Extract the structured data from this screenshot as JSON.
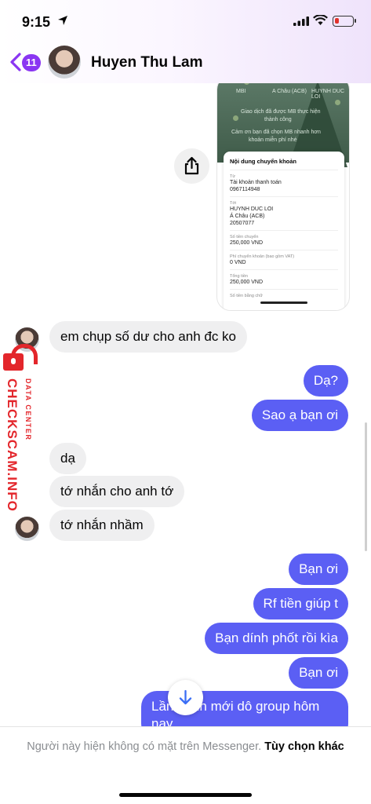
{
  "status_bar": {
    "time": "9:15"
  },
  "header": {
    "back_badge": "11",
    "contact_name": "Huyen Thu Lam"
  },
  "shared_image": {
    "faint_lines": [
      "MBI",
      "A Châu (ACB)",
      "HUYNH DUC LOI",
      "Giao dịch đã được MB thực hiện",
      "thành công",
      "Cảm ơn bạn đã chọn MB nhanh hơn",
      "khoản miễn phí nhé"
    ],
    "card_title": "Nội dung chuyển khoản",
    "fields": [
      {
        "label": "Từ",
        "lines": [
          "Tài khoản thanh toán",
          "0967114948"
        ]
      },
      {
        "label": "Tới",
        "lines": [
          "HUYNH DUC LOI",
          "Á Châu (ACB)",
          "20507077"
        ]
      },
      {
        "label": "Số tiền chuyển",
        "lines": [
          "250,000 VND"
        ]
      },
      {
        "label": "Phí chuyển khoản (bao gồm VAT)",
        "lines": [
          "0 VND"
        ]
      },
      {
        "label": "Tổng tiền",
        "lines": [
          "250,000 VND"
        ]
      },
      {
        "label": "Số tiền bằng chữ",
        "lines": []
      }
    ]
  },
  "watermark": {
    "brand": "CHECKSCAM.INFO",
    "sub": "DATA CENTER"
  },
  "messages": [
    {
      "dir": "in",
      "text": "em chụp số dư cho anh đc ko"
    },
    {
      "dir": "out",
      "text": "Dạ?"
    },
    {
      "dir": "out",
      "text": "Sao ạ bạn ơi"
    },
    {
      "dir": "in",
      "text": "dạ"
    },
    {
      "dir": "in",
      "text": "tớ nhắn cho anh tớ"
    },
    {
      "dir": "in",
      "text": "tớ nhắn nhầm"
    },
    {
      "dir": "out",
      "text": "Bạn ơi"
    },
    {
      "dir": "out",
      "text": "Rf tiền giúp t"
    },
    {
      "dir": "out",
      "text": "Bạn dính phốt rồi kìa"
    },
    {
      "dir": "out",
      "text": "Bạn ơi"
    },
    {
      "dir": "out",
      "text": "Lần mình mới dô group hôm nay"
    }
  ],
  "footer": {
    "notice": "Người này hiện không có mặt trên Messenger.",
    "link": "Tùy chọn khác"
  }
}
